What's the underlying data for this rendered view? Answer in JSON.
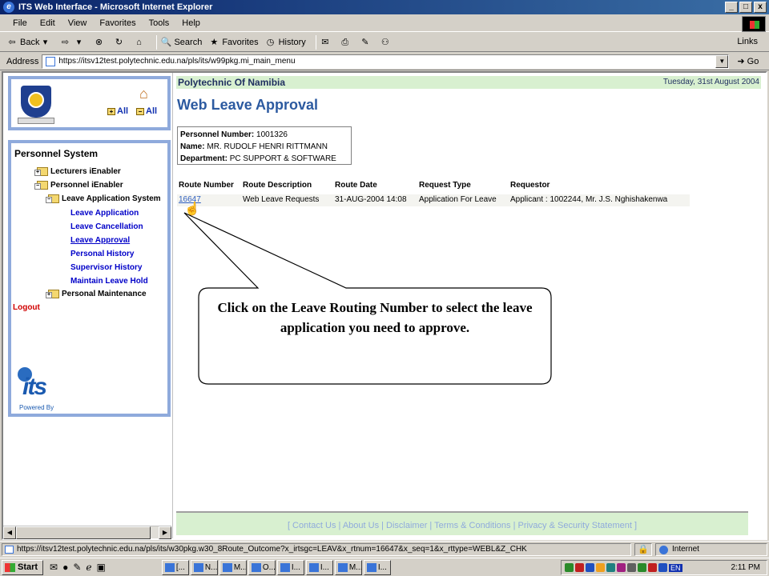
{
  "window": {
    "title": "ITS Web Interface - Microsoft Internet Explorer",
    "buttons": [
      "_",
      "□",
      "x"
    ]
  },
  "menubar": [
    "File",
    "Edit",
    "View",
    "Favorites",
    "Tools",
    "Help"
  ],
  "toolbar": {
    "back": "Back",
    "search": "Search",
    "favorites": "Favorites",
    "history": "History",
    "links": "Links"
  },
  "address": {
    "label": "Address",
    "url": "https://itsv12test.polytechnic.edu.na/pls/its/w99pkg.mi_main_menu",
    "go": "Go"
  },
  "sidebar": {
    "all_label_1": "All",
    "all_label_2": "All",
    "menu_title": "Personnel System",
    "tree": [
      {
        "label": "Lecturers iEnabler"
      },
      {
        "label": "Personnel iEnabler"
      },
      {
        "label": "Leave Application System"
      }
    ],
    "links": [
      {
        "label": "Leave Application"
      },
      {
        "label": "Leave Cancellation"
      },
      {
        "label": "Leave Approval"
      },
      {
        "label": "Personal History"
      },
      {
        "label": "Supervisor History"
      },
      {
        "label": "Maintain Leave Hold"
      }
    ],
    "personal_maintenance": "Personal Maintenance",
    "logout": "Logout",
    "powered_by": "Powered By",
    "its_logo_text": "its"
  },
  "main": {
    "org": "Polytechnic Of Namibia",
    "date": "Tuesday, 31st August 2004",
    "title": "Web Leave Approval",
    "personnel_number_label": "Personnel Number:",
    "personnel_number": "1001326",
    "name_label": "Name:",
    "name": "MR. RUDOLF HENRI RITTMANN",
    "department_label": "Department:",
    "department": "PC SUPPORT & SOFTWARE",
    "columns": [
      "Route Number",
      "Route Description",
      "Route Date",
      "Request Type",
      "Requestor"
    ],
    "rows": [
      {
        "route_number": "16647",
        "route_description": "Web Leave Requests",
        "route_date": "31-AUG-2004 14:08",
        "request_type": "Application For Leave",
        "requestor": "Applicant : 1002244, Mr. J.S. Nghishakenwa"
      }
    ],
    "footer": "[ Contact Us | About Us | Disclaimer | Terms & Conditions | Privacy & Security Statement ]"
  },
  "callout": {
    "text": "Click on the Leave Routing Number to select the leave application you need to approve."
  },
  "statusbar": {
    "url": "https://itsv12test.polytechnic.edu.na/pls/its/w30pkg.w30_8Route_Outcome?x_irtsgc=LEAV&x_rtnum=16647&x_seq=1&x_rttype=WEBL&Z_CHK",
    "zone": "Internet"
  },
  "taskbar": {
    "start": "Start",
    "tasks": [
      "[...",
      "N...",
      "M...",
      "O...",
      "I...",
      "I...",
      "M...",
      "I..."
    ],
    "lang": "EN",
    "clock": "2:11 PM"
  }
}
